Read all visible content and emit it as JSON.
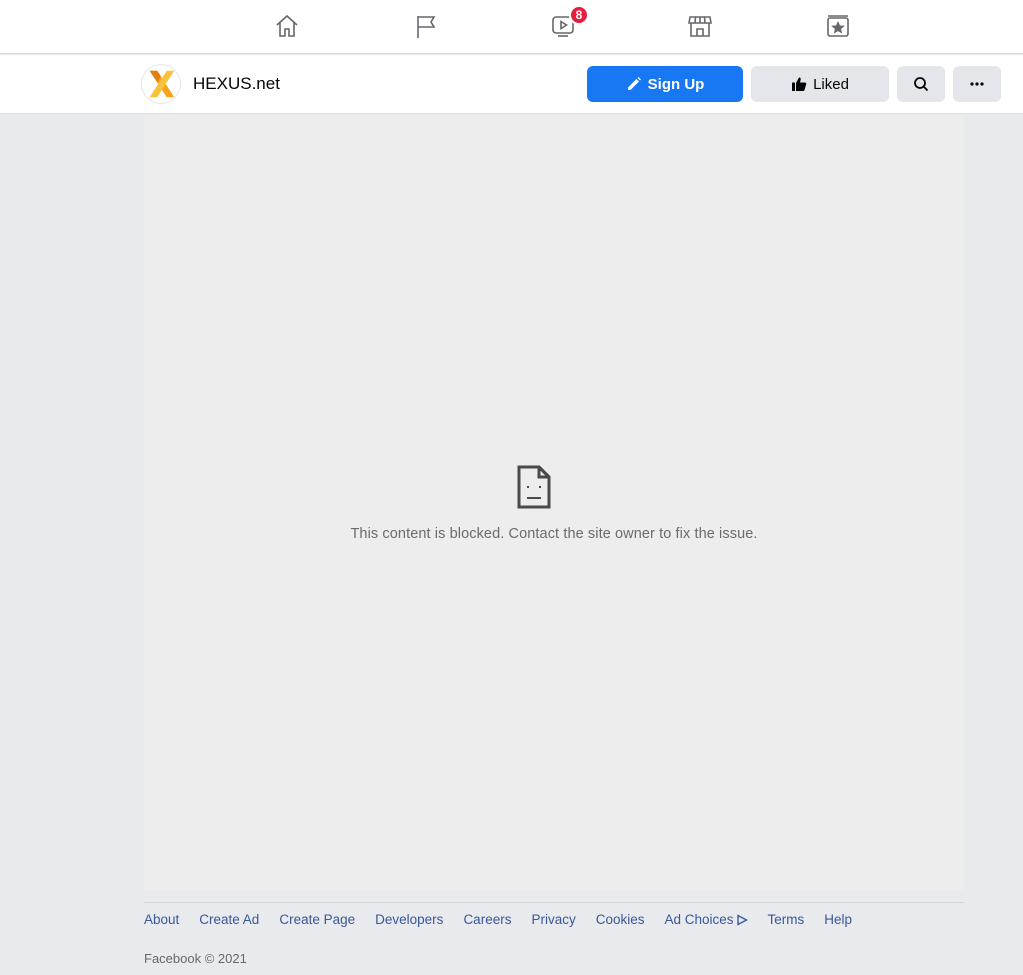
{
  "topnav": {
    "items": [
      {
        "name": "home",
        "icon": "home-icon"
      },
      {
        "name": "pages",
        "icon": "flag-icon"
      },
      {
        "name": "watch",
        "icon": "video-icon",
        "badge": "8"
      },
      {
        "name": "marketplace",
        "icon": "store-icon"
      },
      {
        "name": "events",
        "icon": "calendar-star-icon"
      }
    ]
  },
  "page": {
    "name": "HEXUS.net",
    "avatar_icon": "hexus-x-logo"
  },
  "actions": {
    "sign_up": "Sign Up",
    "liked": "Liked",
    "search_icon": "search-icon",
    "more_icon": "more-icon"
  },
  "content": {
    "blocked_message": "This content is blocked. Contact the site owner to fix the issue.",
    "blocked_icon": "sad-document-icon"
  },
  "footer": {
    "links": [
      "About",
      "Create Ad",
      "Create Page",
      "Developers",
      "Careers",
      "Privacy",
      "Cookies",
      "Ad Choices",
      "Terms",
      "Help"
    ],
    "copyright": "Facebook © 2021"
  },
  "colors": {
    "primary": "#1877f2",
    "badge": "#e41e3f",
    "link": "#385898"
  }
}
